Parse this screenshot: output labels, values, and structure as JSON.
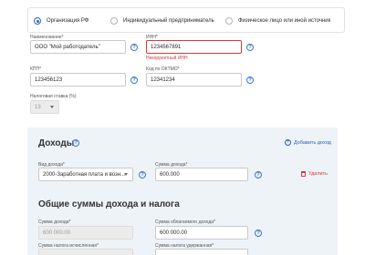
{
  "taxpayer_type": {
    "options": [
      {
        "label": "Организация РФ",
        "selected": true
      },
      {
        "label": "Индивидуальный предприниматель",
        "selected": false
      },
      {
        "label": "Физическое лицо или иной источник",
        "selected": false
      }
    ]
  },
  "fields": {
    "name": {
      "label": "Наименование*",
      "value": "ООО \"Мой работодатель\""
    },
    "inn": {
      "label": "ИНН*",
      "value": "1234567891",
      "error": "Некорректный ИНН"
    },
    "kpp": {
      "label": "КПП*",
      "value": "123456123"
    },
    "oktmo": {
      "label": "Код по ОКТМО*",
      "value": "12341234"
    },
    "tax_rate": {
      "label": "Налоговая ставка (%)",
      "value": "13"
    }
  },
  "income": {
    "title": "Доходы",
    "add_label": "Добавить доход",
    "type_label": "Вид дохода*",
    "type_value": "2000-Заработная плата и возн...",
    "amount_label": "Сумма дохода*",
    "amount_value": "600.000",
    "delete_label": "Удалить"
  },
  "totals": {
    "title": "Общие суммы дохода и налога",
    "income_sum_label": "Сумма дохода*",
    "income_sum_value": "600 000.00",
    "taxable_sum_label": "Сумма облагаемого дохода*",
    "taxable_sum_value": "600 000.00",
    "tax_calc_label": "Сумма налога исчисленная*",
    "tax_withheld_label": "Сумма налога удержанная*"
  },
  "colors": {
    "accent": "#2a63b8",
    "error": "#d93a3a",
    "panel": "#eef3f8"
  }
}
